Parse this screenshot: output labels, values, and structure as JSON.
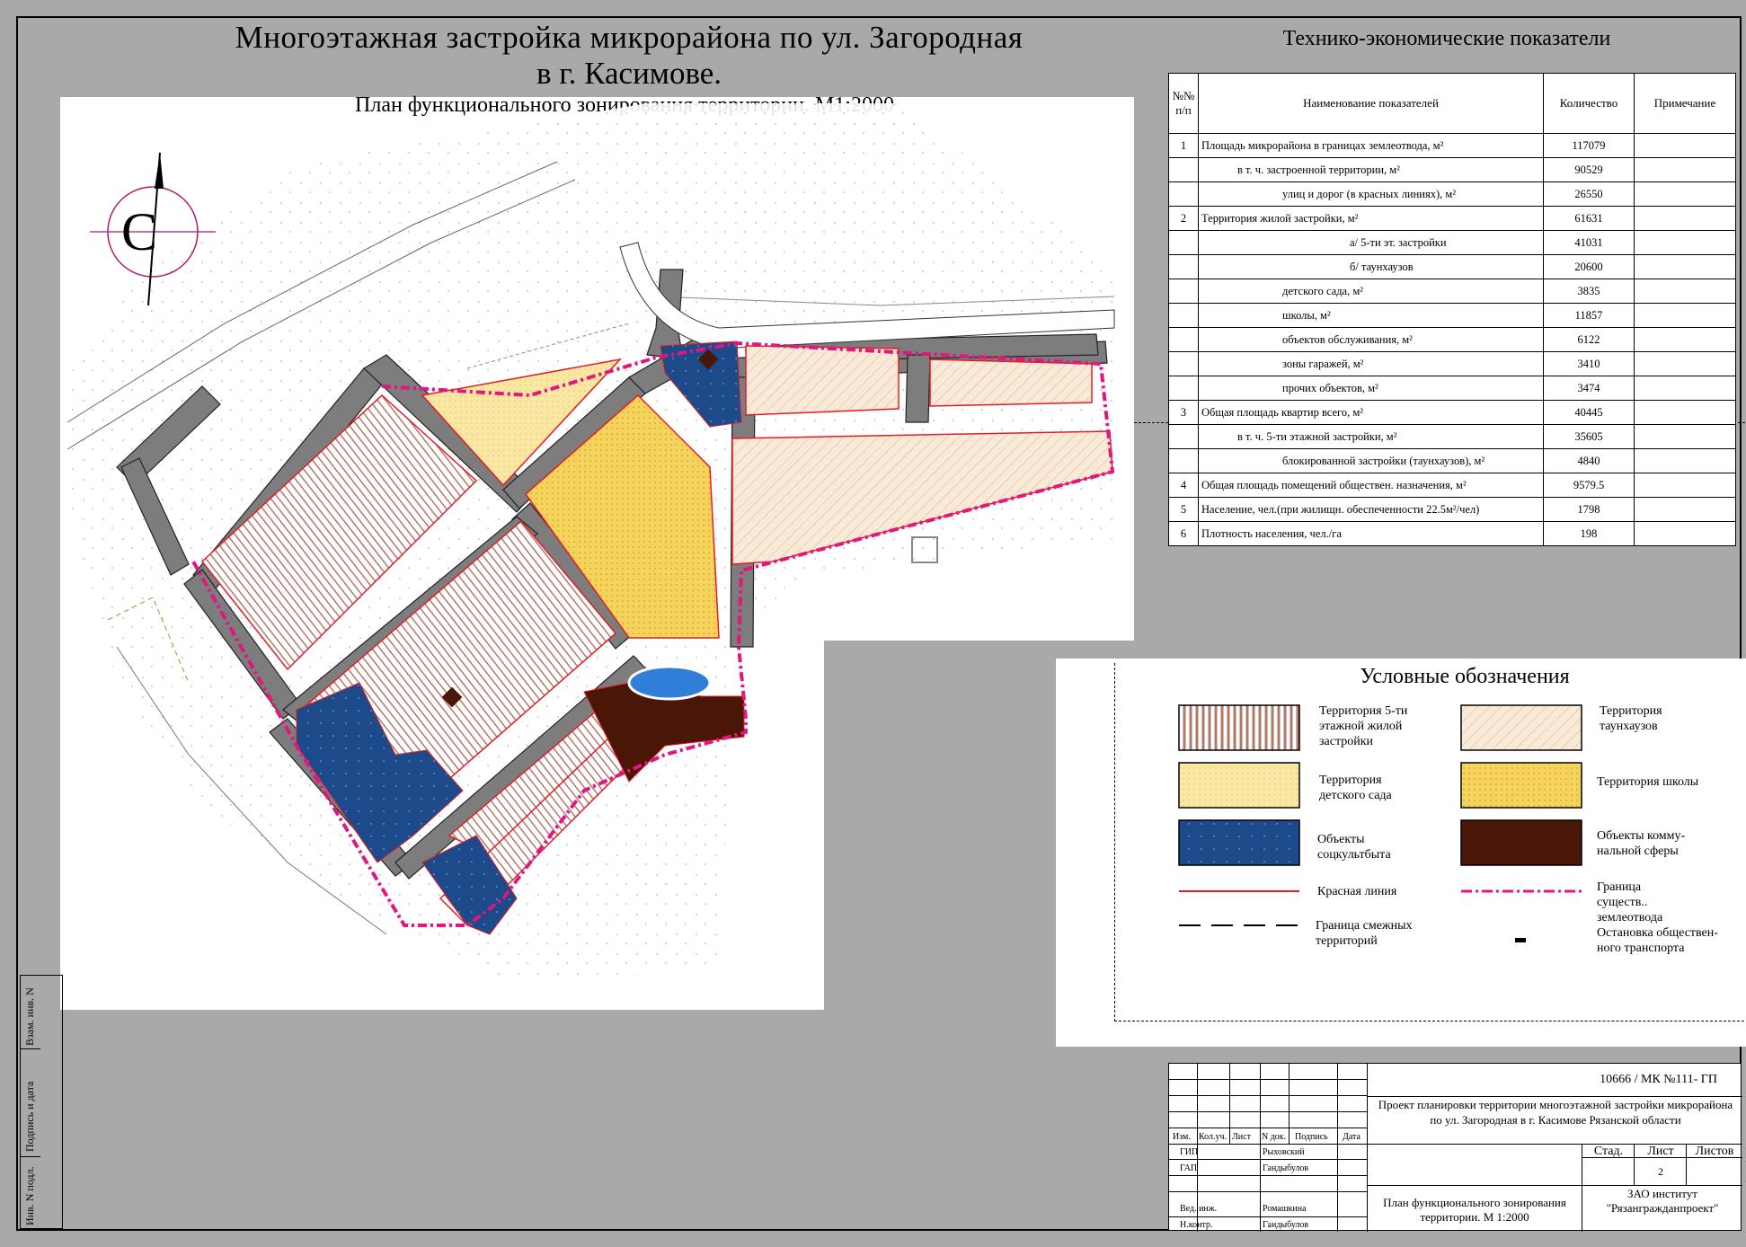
{
  "title": {
    "line1": "Многоэтажная  застройка  микрорайона  по  ул. Загородная",
    "line2": "в  г. Касимове.",
    "subtitle": "План  функционального  зонирования  территории.  М1:2000"
  },
  "compass": {
    "letter": "С",
    "icon": "north-arrow-icon"
  },
  "tep": {
    "title": "Технико-экономические показатели",
    "headers": {
      "num": "№№ п/п",
      "name": "Наименование показателей",
      "qty": "Количество",
      "note": "Примечание"
    },
    "rows": [
      {
        "num": "1",
        "name": "Площадь  микрорайона  в  границах  землеотвода, м²",
        "qty": "117079",
        "indent": 0
      },
      {
        "num": "",
        "name": "в  т. ч. застроенной  территории, м²",
        "qty": "90529",
        "indent": 1
      },
      {
        "num": "",
        "name": "улиц  и  дорог  (в  красных  линиях), м²",
        "qty": "26550",
        "indent": 2
      },
      {
        "num": "2",
        "name": "Территория  жилой  застройки, м²",
        "qty": "61631",
        "indent": 0
      },
      {
        "num": "",
        "name": "а/ 5-ти  эт.  застройки",
        "qty": "41031",
        "indent": 3
      },
      {
        "num": "",
        "name": "б/ таунхаузов",
        "qty": "20600",
        "indent": 3
      },
      {
        "num": "",
        "name": "детского  сада, м²",
        "qty": "3835",
        "indent": 2
      },
      {
        "num": "",
        "name": "школы, м²",
        "qty": "11857",
        "indent": 2
      },
      {
        "num": "",
        "name": "объектов  обслуживания, м²",
        "qty": "6122",
        "indent": 2
      },
      {
        "num": "",
        "name": "зоны  гаражей, м²",
        "qty": "3410",
        "indent": 2
      },
      {
        "num": "",
        "name": "прочих  объектов, м²",
        "qty": "3474",
        "indent": 2
      },
      {
        "num": "3",
        "name": "Общая  площадь  квартир  всего, м²",
        "qty": "40445",
        "indent": 0
      },
      {
        "num": "",
        "name": "в  т. ч. 5-ти  этажной  застройки, м²",
        "qty": "35605",
        "indent": 1
      },
      {
        "num": "",
        "name": "блокированной  застройки  (таунхаузов), м²",
        "qty": "4840",
        "indent": 2
      },
      {
        "num": "4",
        "name": "Общая  площадь  помещений  обществен.  назначения, м²",
        "qty": "9579.5",
        "indent": 0
      },
      {
        "num": "5",
        "name": "Население,  чел.(при  жилищн.  обеспеченности  22.5м²/чел)",
        "qty": "1798",
        "indent": 0
      },
      {
        "num": "6",
        "name": "Плотность  населения,  чел./га",
        "qty": "198",
        "indent": 0
      }
    ]
  },
  "legend": {
    "title": "Условные  обозначения",
    "items": {
      "five_storey": "Территория  5-ти этажной  жилой застройки",
      "townhouse": "Территория таунхаузов",
      "kindergarten": "Территория детского сада",
      "school": "Территория  школы",
      "social": "Объекты соцкультбыта",
      "communal": "Объекты  комму- нальной  сферы",
      "red_line": "Красная  линия",
      "boundary": "Граница  существ.. землеотвода",
      "adjacent": "Граница  смежных территорий",
      "bus_stop": "Остановка  обществен- ного  транспорта"
    }
  },
  "stamp": {
    "code": "10666 / МК №111-  ГП",
    "project": "Проект  планировки  территории многоэтажной  застройки  микрорайона  по  ул. Загородная в  г. Касимове  Рязанской  области",
    "cols": {
      "izm": "Изм.",
      "kol": "Кол.уч.",
      "list": "Лист",
      "ndok": "N  док.",
      "podp": "Подпись",
      "data": "Дата"
    },
    "staff": [
      {
        "role": "ГИП",
        "name": "Рыховский"
      },
      {
        "role": "ГАП",
        "name": "Гандыбулов"
      },
      {
        "role": "Вед. инж.",
        "name": "Ромашкина"
      },
      {
        "role": "Н.контр.",
        "name": "Гандыбулов"
      }
    ],
    "stage_label": "Стад.",
    "sheet_label": "Лист",
    "sheets_label": "Листов",
    "sheet_value": "2",
    "sheet_title": "План  функционального зонирования  территории. М 1:2000",
    "org": "ЗАО институт \"Рязангражданпроект\""
  },
  "side_strip": {
    "vzam": "Взам. инв. N",
    "podp": "Подпись и дата",
    "inv": "Инв. N подл."
  },
  "colors": {
    "five_storey": "#b28272",
    "townhouse": "#f7e8d3",
    "kindergarten": "#fbe8a6",
    "school": "#f6d55e",
    "social": "#1f4a8c",
    "communal": "#4a1608",
    "road": "#808080",
    "red_line": "#e41c24",
    "boundary": "#e3157f"
  }
}
